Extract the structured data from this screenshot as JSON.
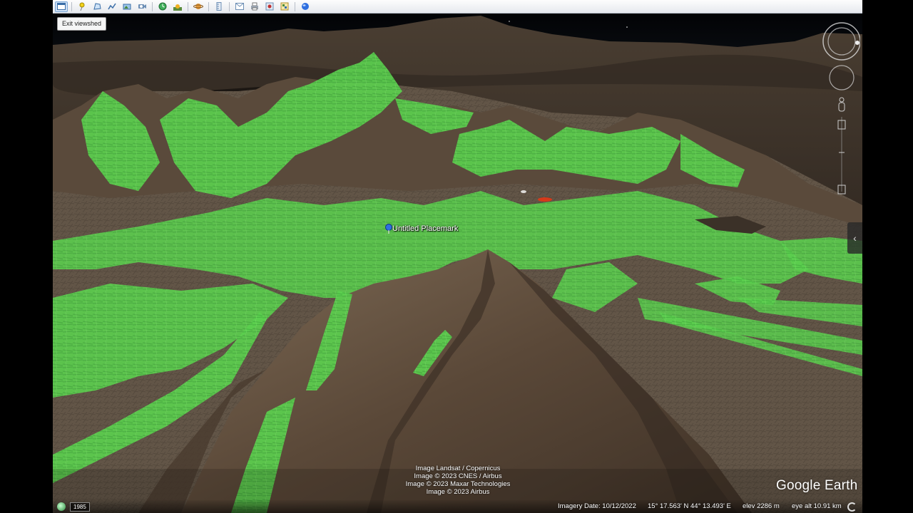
{
  "toolbar": {
    "buttons": [
      "sidebar-toggle",
      "placemark",
      "polygon",
      "path",
      "overlay",
      "tour",
      "historical-imagery",
      "sunlight",
      "planets",
      "ruler",
      "email",
      "print",
      "save-image",
      "view-maps",
      "earth"
    ]
  },
  "viewshed": {
    "exit_label": "Exit viewshed"
  },
  "placemark": {
    "label": "Untitled Placemark",
    "pin_color": "#2f6fe0"
  },
  "colors": {
    "visible_area": "#5ad24a",
    "terrain": "#6b5a48",
    "sky": "#05070a"
  },
  "attribution": {
    "lines": [
      "Image Landsat / Copernicus",
      "Image © 2023 CNES / Airbus",
      "Image © 2023 Maxar Technologies",
      "Image © 2023 Airbus"
    ]
  },
  "logo": "Google Earth",
  "status": {
    "historical_year": "1985",
    "imagery_date": "Imagery Date: 10/12/2022",
    "coordinates": "15° 17.563' N    44° 13.493' E",
    "elevation": "elev  2286 m",
    "eye_alt": "eye alt  10.91 km"
  },
  "nav": {
    "look_icon": "look-joystick",
    "move_icon": "move-joystick",
    "zoom_icon": "zoom-slider",
    "street_view_icon": "pegman"
  }
}
